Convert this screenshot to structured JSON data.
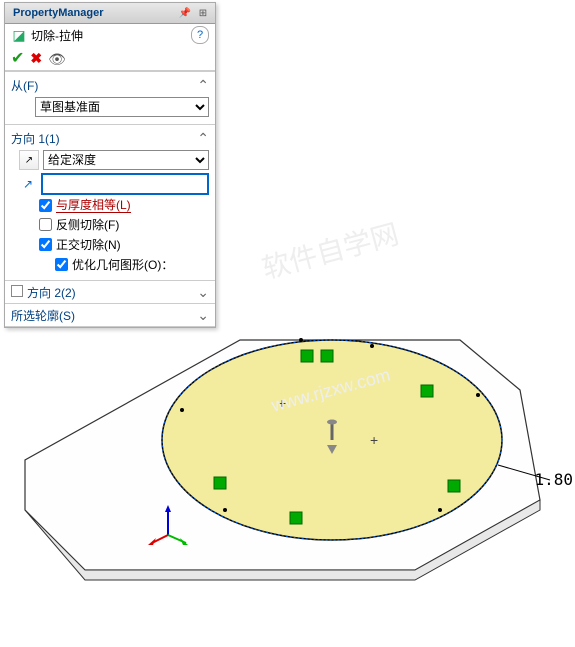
{
  "titlebar": {
    "text": "PropertyManager"
  },
  "feature": {
    "name": "切除-拉伸"
  },
  "from": {
    "title": "从(F)",
    "option": "草图基准面"
  },
  "dir1": {
    "title": "方向 1(1)",
    "endcond": "给定深度",
    "depth": "",
    "cb_thickness": "与厚度相等(L)",
    "cb_flip": "反侧切除(F)",
    "cb_normal": "正交切除(N)",
    "cb_optimize": "优化几何图形(O)："
  },
  "dir2": {
    "title": "方向 2(2)"
  },
  "contour": {
    "title": "所选轮廓(S)"
  },
  "dim": {
    "value": "1.80"
  }
}
